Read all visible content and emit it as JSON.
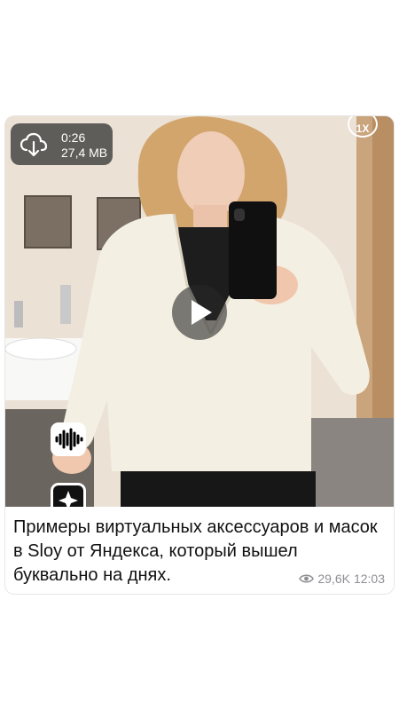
{
  "video": {
    "duration": "0:26",
    "file_size": "27,4 MB",
    "speed": "1X",
    "icons": {
      "download": "cloud-download-icon",
      "play": "play-icon",
      "speed": "speed-icon",
      "overlay_1": "sound-wave-icon",
      "overlay_2": "sparkle-icon"
    }
  },
  "message": {
    "text": "Примеры виртуальных аксессуаров и масок в Sloy от Яндекса, который вышел буквально на днях.",
    "views": "29,6K",
    "time": "12:03"
  },
  "colors": {
    "card_background": "#ffffff",
    "badge_background": "#373737",
    "meta_text": "#8e8e93"
  }
}
